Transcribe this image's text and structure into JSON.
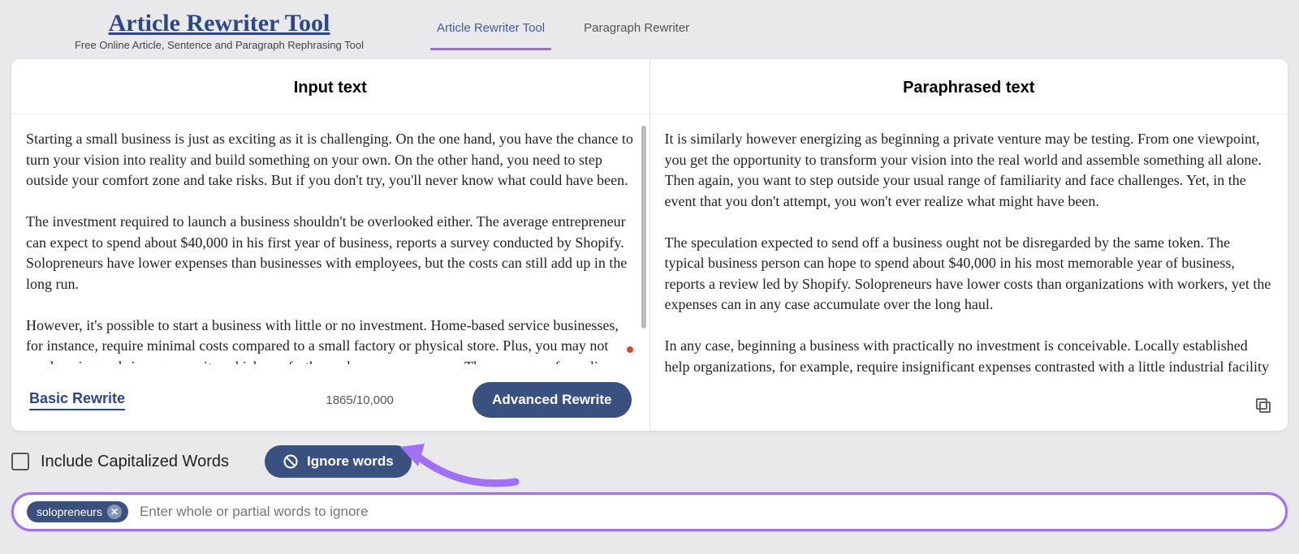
{
  "brand": {
    "title": "Article Rewriter Tool",
    "subtitle": "Free Online Article, Sentence and Paragraph Rephrasing Tool"
  },
  "tabs": {
    "rewriter": "Article Rewriter Tool",
    "paragraph": "Paragraph Rewriter"
  },
  "panes": {
    "input_header": "Input text",
    "output_header": "Paraphrased text",
    "input_text": "Starting a small business is just as exciting as it is challenging. On the one hand, you have the chance to turn your vision into reality and build something on your own. On the other hand, you need to step outside your comfort zone and take risks. But if you don't try, you'll never know what could have been.\n\nThe investment required to launch a business shouldn't be overlooked either. The average entrepreneur can expect to spend about $40,000 in his first year of business, reports a survey conducted by Shopify. Solopreneurs have lower expenses than businesses with employees, but the costs can still add up in the long run.\n\nHowever, it's possible to start a business with little or no investment. Home-based service businesses, for instance, require minimal costs compared to a small factory or physical store. Plus, you may not need zoning and signage permits, which can further reduce your expenses. The same goes for online",
    "output_text": "It is similarly however energizing as beginning a private venture may be testing. From one viewpoint, you get the opportunity to transform your vision into the real world and assemble something all alone. Then again, you want to step outside your usual range of familiarity and face challenges. Yet, in the event that you don't attempt, you won't ever realize what might have been.\n\nThe speculation expected to send off a business ought not be disregarded by the same token. The typical business person can hope to spend about $40,000 in his most memorable year of business, reports a review led by Shopify. Solopreneurs have lower costs than organizations with workers, yet the expenses can in any case accumulate over the long haul.\n\nIn any case, beginning a business with practically no investment is conceivable. Locally established help organizations, for example, require insignificant expenses contrasted with a little industrial facility"
  },
  "footer": {
    "basic": "Basic Rewrite",
    "counter": "1865/10,000",
    "advanced": "Advanced Rewrite"
  },
  "options": {
    "include_cap": "Include Capitalized Words",
    "ignore_btn": "Ignore words"
  },
  "ignore_field": {
    "chip": "solopreneurs",
    "placeholder": "Enter whole or partial words to ignore"
  }
}
